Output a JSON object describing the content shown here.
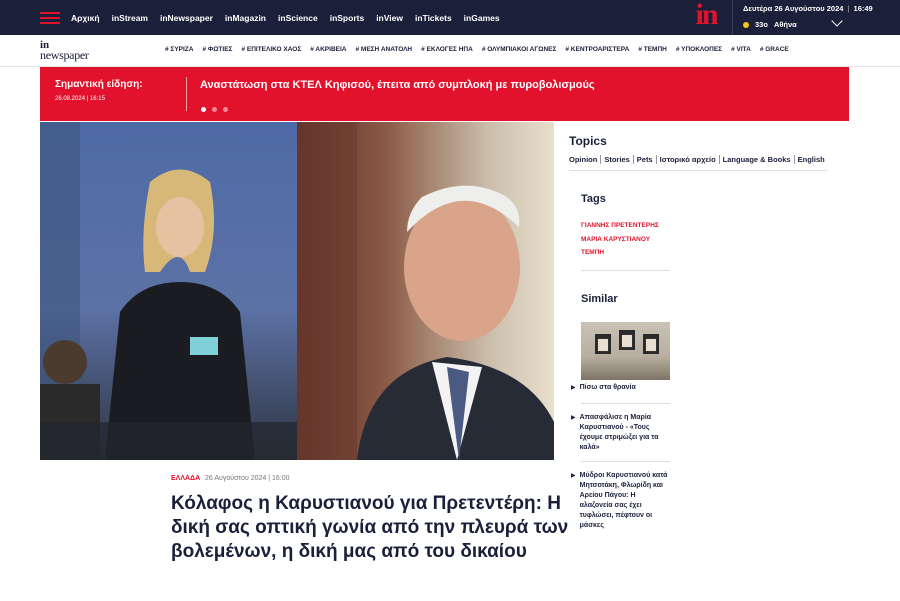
{
  "topbar": {
    "nav": [
      "Αρχική",
      "Stream",
      "Newspaper",
      "Magazin",
      "Science",
      "Sports",
      "View",
      "Tickets",
      "Games"
    ],
    "logo": "in",
    "date": "Δευτέρα 26 Αυγούστου 2024",
    "time": "16:49",
    "temperature": "33ο",
    "city": "Αθήνα"
  },
  "secbar": {
    "logo_line1": "in",
    "logo_line2": "newspaper",
    "tags": [
      "# ΣΥΡΙΖΑ",
      "# ΦΩΤΙΕΣ",
      "# ΕΠΙΤΕΛΙΚΟ ΧΑΟΣ",
      "# ΑΚΡΙΒΕΙΑ",
      "# ΜΕΣΗ ΑΝΑΤΟΛΗ",
      "# ΕΚΛΟΓΕΣ ΗΠΑ",
      "# ΟΛΥΜΠΙΑΚΟΙ ΑΓΩΝΕΣ",
      "# ΚΕΝΤΡΟΑΡΙΣΤΕΡΑ",
      "# ΤΕΜΠΗ",
      "# ΥΠΟΚΛΟΠΕΣ",
      "# VITA",
      "# GRACE"
    ]
  },
  "breaking": {
    "label": "Σημαντική είδηση:",
    "time": "26.08.2024 | 16:15",
    "headline": "Αναστάτωση στα ΚΤΕΛ Κηφισού, έπειτα από συμπλοκή με πυροβολισμούς"
  },
  "article": {
    "category": "ΕΛΛΑΔΑ",
    "date": "26 Αυγούστου 2024 | 16:00",
    "title": "Κόλαφος η Καρυστιανού για Πρετεντέρη: Η δική σας οπτική γωνία από την πλευρά των βολεμένων, η δική μας από του δικαίου"
  },
  "sidebar": {
    "topics_title": "Topics",
    "topics": [
      "Opinion",
      "Stories",
      "Pets",
      "Ιστορικό αρχείο",
      "Language & Books",
      "English"
    ],
    "tags_title": "Tags",
    "tags": [
      "ΓΙΑΝΝΗΣ ΠΡΕΤΕΝΤΕΡΗΣ",
      "ΜΑΡΙΑ ΚΑΡΥΣΤΙΑΝΟΥ",
      "ΤΕΜΠΗ"
    ],
    "similar_title": "Similar",
    "similar": [
      "Πίσω στα θρανία",
      "Απασφάλισε η Μαρία Καρυστιανού - «Τους έχουμε στριμώξει για τα καλά»",
      "Μύδροι Καρυστιανού κατά Μητσοτάκη, Φλωρίδη και Αρείου Πάγου: Η αλαζονεία σας έχει τυφλώσει, πέφτουν οι μάσκες"
    ]
  },
  "colors": {
    "brand_red": "#e3122c",
    "navy": "#1a1f3a"
  }
}
